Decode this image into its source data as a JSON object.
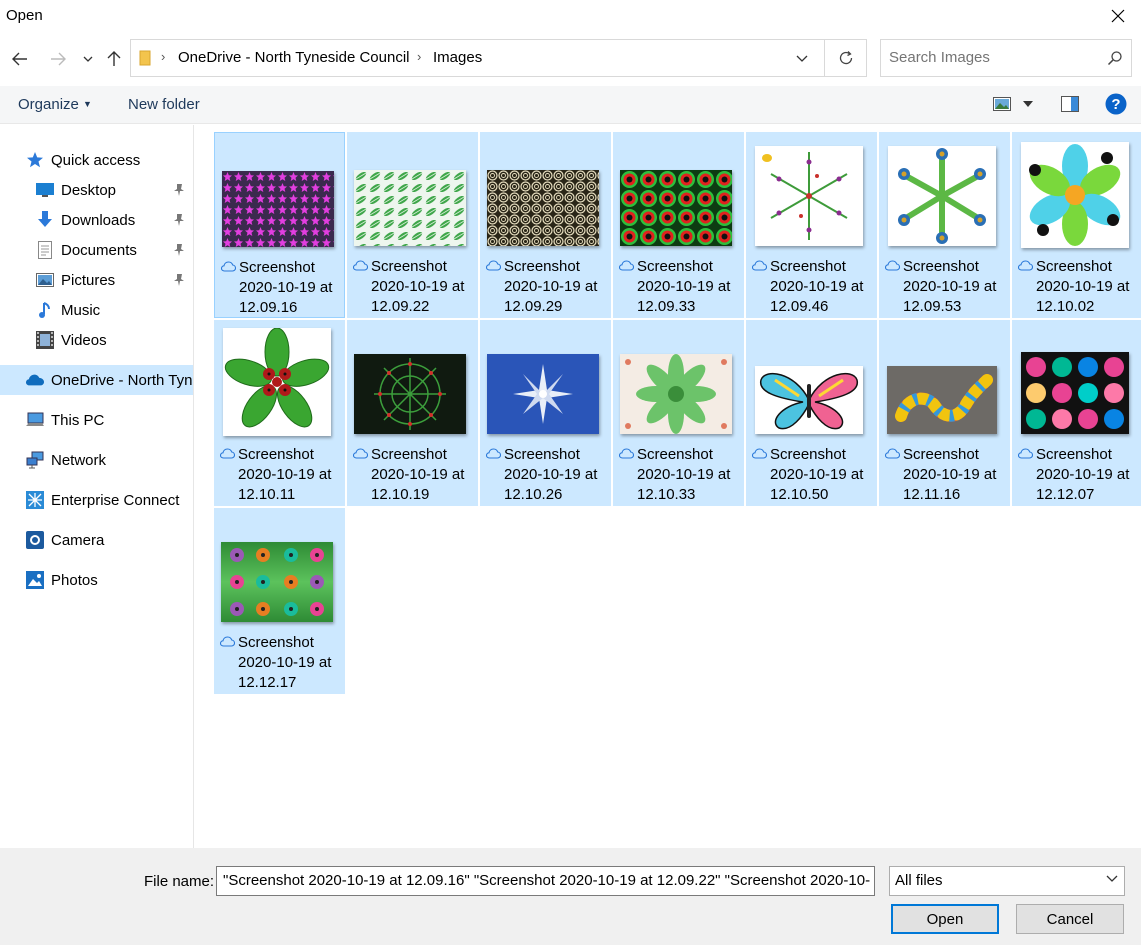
{
  "window": {
    "title": "Open"
  },
  "address": {
    "crumbs": [
      "OneDrive - North Tyneside Council",
      "Images"
    ]
  },
  "search": {
    "placeholder": "Search Images"
  },
  "toolbar": {
    "organize": "Organize",
    "new_folder": "New folder"
  },
  "sidebar": {
    "items": [
      {
        "label": "Quick access",
        "icon": "star-icon"
      },
      {
        "label": "Desktop",
        "icon": "desktop-icon",
        "pinned": true
      },
      {
        "label": "Downloads",
        "icon": "downloads-icon",
        "pinned": true
      },
      {
        "label": "Documents",
        "icon": "documents-icon",
        "pinned": true
      },
      {
        "label": "Pictures",
        "icon": "pictures-icon",
        "pinned": true
      },
      {
        "label": "Music",
        "icon": "music-icon"
      },
      {
        "label": "Videos",
        "icon": "videos-icon"
      },
      {
        "label": "OneDrive - North Tyneside Council",
        "icon": "onedrive-icon",
        "selected": true
      },
      {
        "label": "This PC",
        "icon": "pc-icon"
      },
      {
        "label": "Network",
        "icon": "network-icon"
      },
      {
        "label": "Enterprise Connect",
        "icon": "enterprise-icon"
      },
      {
        "label": "Camera",
        "icon": "camera-icon"
      },
      {
        "label": "Photos",
        "icon": "photos-icon"
      }
    ]
  },
  "files": [
    {
      "line1": "Screenshot",
      "line2": "2020-10-19 at",
      "line3": "12.09.16",
      "thumb": "magenta-stars"
    },
    {
      "line1": "Screenshot",
      "line2": "2020-10-19 at",
      "line3": "12.09.22",
      "thumb": "green-leaves"
    },
    {
      "line1": "Screenshot",
      "line2": "2020-10-19 at",
      "line3": "12.09.29",
      "thumb": "spirals"
    },
    {
      "line1": "Screenshot",
      "line2": "2020-10-19 at",
      "line3": "12.09.33",
      "thumb": "red-green-rings"
    },
    {
      "line1": "Screenshot",
      "line2": "2020-10-19 at",
      "line3": "12.09.46",
      "thumb": "vine-mandala"
    },
    {
      "line1": "Screenshot",
      "line2": "2020-10-19 at",
      "line3": "12.09.53",
      "thumb": "peacock"
    },
    {
      "line1": "Screenshot",
      "line2": "2020-10-19 at",
      "line3": "12.10.02",
      "thumb": "toucan"
    },
    {
      "line1": "Screenshot",
      "line2": "2020-10-19 at",
      "line3": "12.10.11",
      "thumb": "ladybird-leaves"
    },
    {
      "line1": "Screenshot",
      "line2": "2020-10-19 at",
      "line3": "12.10.19",
      "thumb": "dark-mandala"
    },
    {
      "line1": "Screenshot",
      "line2": "2020-10-19 at",
      "line3": "12.10.26",
      "thumb": "blue-star"
    },
    {
      "line1": "Screenshot",
      "line2": "2020-10-19 at",
      "line3": "12.10.33",
      "thumb": "green-mandala"
    },
    {
      "line1": "Screenshot",
      "line2": "2020-10-19 at",
      "line3": "12.10.50",
      "thumb": "butterfly"
    },
    {
      "line1": "Screenshot",
      "line2": "2020-10-19 at",
      "line3": "12.11.16",
      "thumb": "snake"
    },
    {
      "line1": "Screenshot",
      "line2": "2020-10-19 at",
      "line3": "12.12.07",
      "thumb": "colour-circles"
    },
    {
      "line1": "Screenshot",
      "line2": "2020-10-19 at",
      "line3": "12.12.17",
      "thumb": "flowers-green"
    }
  ],
  "bottom": {
    "file_name_label": "File name:",
    "file_name_value": "\"Screenshot 2020-10-19 at 12.09.16\" \"Screenshot 2020-10-19 at 12.09.22\" \"Screenshot 2020-10-",
    "file_type": "All files",
    "open": "Open",
    "cancel": "Cancel"
  },
  "colors": {
    "selection": "#cce8ff",
    "accent": "#0078d7",
    "link": "#1e395b"
  }
}
